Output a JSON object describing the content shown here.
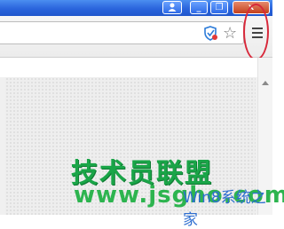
{
  "window": {
    "user_icon": "user-icon",
    "minimize_label": "_",
    "maximize_label": "❐",
    "close_label": "x"
  },
  "toolbar": {
    "star_glyph": "☆",
    "shield_icon": "shield-icon",
    "menu_icon": "hamburger-menu-icon"
  },
  "watermark": {
    "brand_cn": "技术员联盟",
    "url": "www.jsgho.com",
    "site_cn": "Win8系统之家"
  },
  "colors": {
    "titlebar": "#2a64dc",
    "highlight": "#d8283a",
    "watermark_green": "#1aa548",
    "watermark_blue": "#2f6fd0"
  }
}
